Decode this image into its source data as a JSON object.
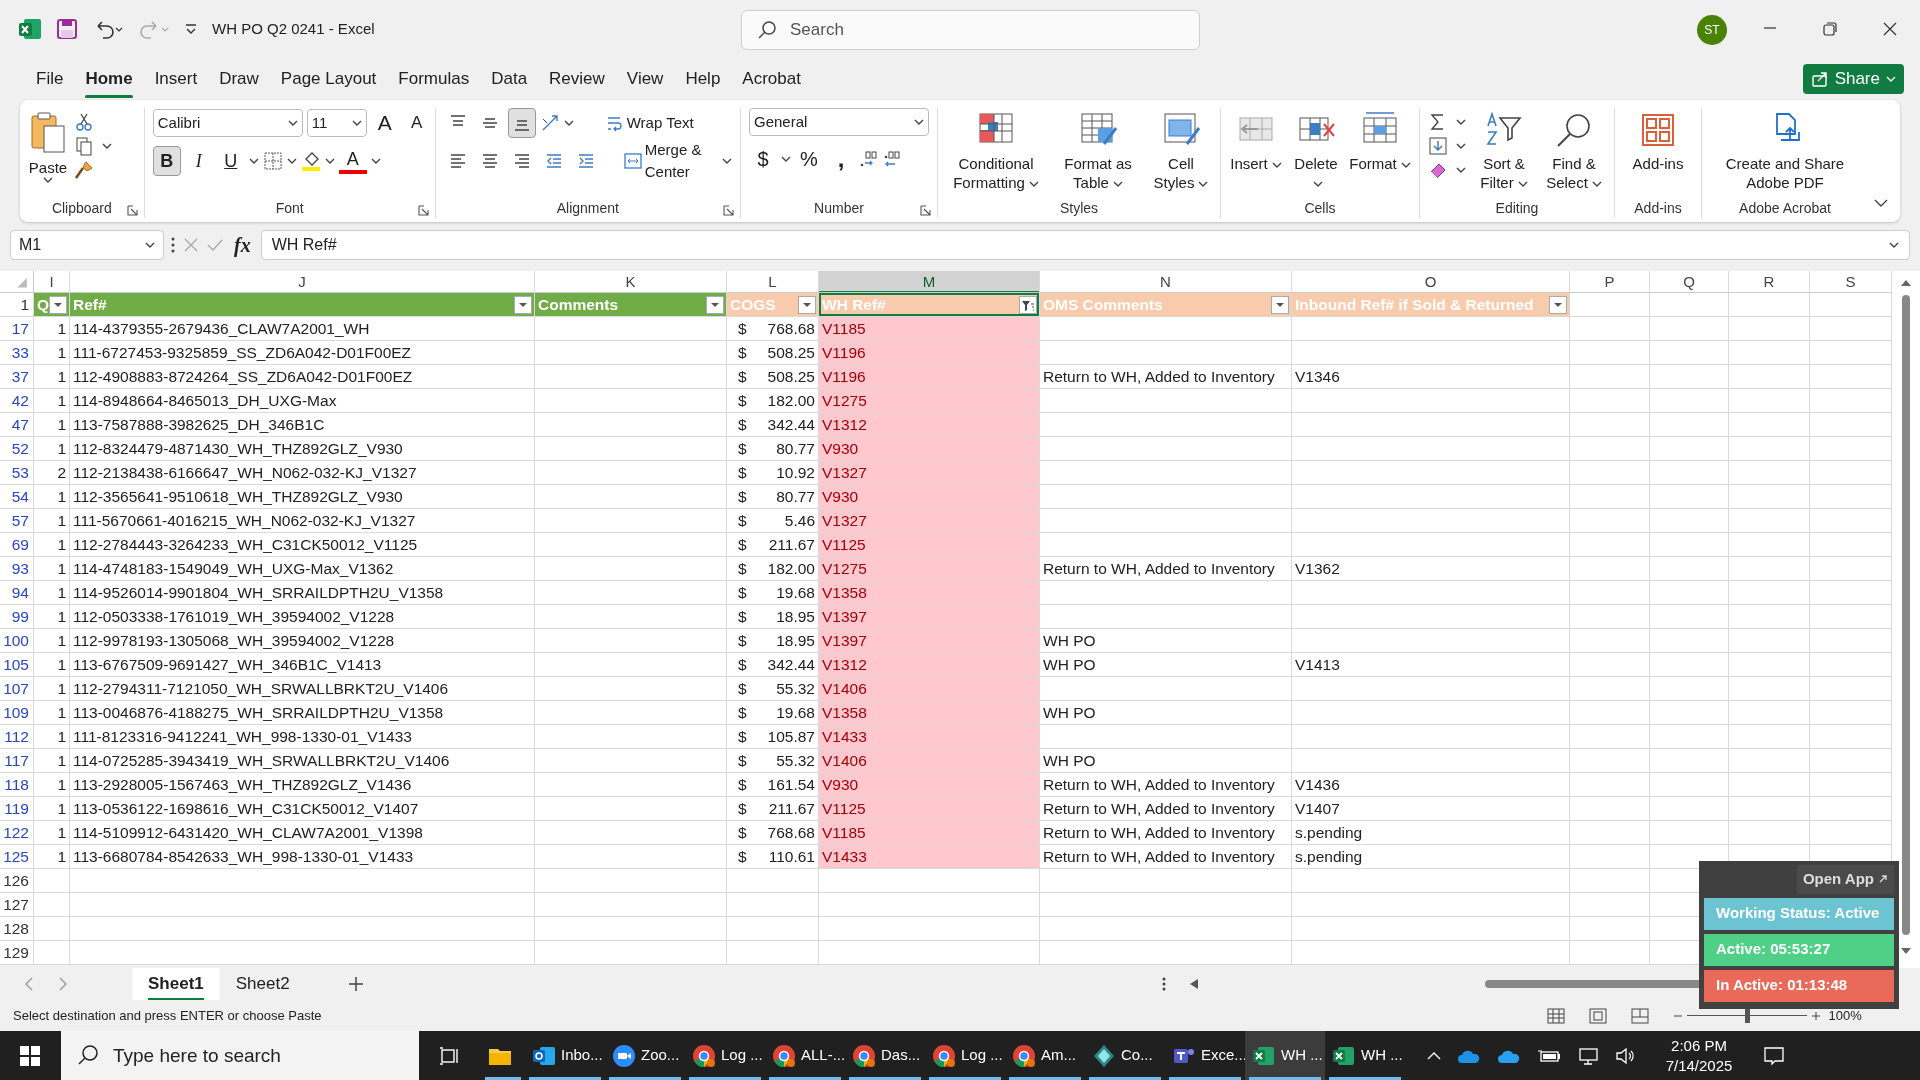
{
  "window": {
    "title": "WH PO Q2 0241  -  Excel",
    "search_placeholder": "Search",
    "avatar": "ST",
    "share": "Share"
  },
  "menu_tabs": [
    {
      "label": "File",
      "selected": false
    },
    {
      "label": "Home",
      "selected": true
    },
    {
      "label": "Insert",
      "selected": false
    },
    {
      "label": "Draw",
      "selected": false
    },
    {
      "label": "Page Layout",
      "selected": false
    },
    {
      "label": "Formulas",
      "selected": false
    },
    {
      "label": "Data",
      "selected": false
    },
    {
      "label": "Review",
      "selected": false
    },
    {
      "label": "View",
      "selected": false
    },
    {
      "label": "Help",
      "selected": false
    },
    {
      "label": "Acrobat",
      "selected": false
    }
  ],
  "ribbon": [
    {
      "kind": "clipboard",
      "label": "Clipboard",
      "paste": "Paste"
    },
    {
      "kind": "font",
      "label": "Font",
      "font_name": "Calibri",
      "font_size": "11",
      "grow": "A",
      "shrink": "A",
      "styles": [
        {
          "text": "B",
          "selected": true
        },
        {
          "text": "I",
          "selected": false
        },
        {
          "text": "U",
          "selected": false
        }
      ],
      "font_color": "A"
    },
    {
      "kind": "alignment",
      "label": "Alignment",
      "vertical": [
        {
          "selected": false
        },
        {
          "selected": false
        },
        {
          "selected": true
        }
      ],
      "wrap": "Wrap Text",
      "merge": "Merge & Center"
    },
    {
      "kind": "number",
      "label": "Number",
      "format": "General",
      "symbols": [
        "$",
        "%",
        ","
      ]
    },
    {
      "kind": "buttons",
      "label": "Styles",
      "buttons": [
        {
          "text": "Conditional Formatting",
          "kind": "conditional",
          "menu": true
        },
        {
          "text": "Format as Table",
          "kind": "table",
          "menu": true
        },
        {
          "text": "Cell Styles",
          "kind": "styles",
          "menu": true
        }
      ]
    },
    {
      "kind": "buttons",
      "label": "Cells",
      "buttons": [
        {
          "text": "Insert",
          "kind": "insert",
          "menu": true
        },
        {
          "text": "Delete",
          "kind": "delete",
          "menu": true
        },
        {
          "text": "Format",
          "kind": "format",
          "menu": true
        }
      ]
    },
    {
      "kind": "editing",
      "label": "Editing",
      "buttons": [
        {
          "text": "Sort & Filter",
          "kind": "sort",
          "menu": true
        },
        {
          "text": "Find & Select",
          "kind": "find",
          "menu": true
        }
      ]
    },
    {
      "kind": "buttons",
      "label": "Add-ins",
      "buttons": [
        {
          "text": "Add-ins",
          "kind": "addins",
          "menu": false
        }
      ]
    },
    {
      "kind": "buttons",
      "label": "Adobe Acrobat",
      "buttons": [
        {
          "text": "Create and Share Adobe PDF",
          "kind": "pdf",
          "menu": false
        }
      ]
    }
  ],
  "formula_bar": {
    "name_box": "M1",
    "fx": "fx",
    "value": "WH Ref#"
  },
  "columns": [
    {
      "letter": "I",
      "selected": false
    },
    {
      "letter": "J",
      "selected": false
    },
    {
      "letter": "K",
      "selected": false
    },
    {
      "letter": "L",
      "selected": false
    },
    {
      "letter": "M",
      "selected": true
    },
    {
      "letter": "N",
      "selected": false
    },
    {
      "letter": "O",
      "selected": false
    },
    {
      "letter": "P",
      "selected": false
    },
    {
      "letter": "Q",
      "selected": false
    },
    {
      "letter": "R",
      "selected": false
    },
    {
      "letter": "S",
      "selected": false
    }
  ],
  "header_row": {
    "number": "1",
    "cells": [
      {
        "text": "Q",
        "color": "#70ad47",
        "filtered": false,
        "selected": false
      },
      {
        "text": "Ref#",
        "color": "#70ad47",
        "filtered": false,
        "selected": false
      },
      {
        "text": "Comments",
        "color": "#70ad47",
        "filtered": false,
        "selected": false
      },
      {
        "text": "COGS",
        "color": "#f8cbad",
        "filtered": false,
        "selected": false
      },
      {
        "text": "WH Ref#",
        "color": "#f8cbad",
        "filtered": true,
        "selected": true
      },
      {
        "text": "OMS Comments",
        "color": "#f8cbad",
        "filtered": false,
        "selected": false
      },
      {
        "text": "Inbound Ref# if Sold & Returned",
        "color": "#f8cbad",
        "filtered": false,
        "selected": false
      }
    ]
  },
  "rows": [
    {
      "number": "17",
      "qty": "1",
      "ref": "114-4379355-2679436_CLAW7A2001_WH",
      "currency": "$",
      "cogs": "768.68",
      "wh_ref": "V1185"
    },
    {
      "number": "33",
      "qty": "1",
      "ref": "111-6727453-9325859_SS_ZD6A042-D01F00EZ",
      "currency": "$",
      "cogs": "508.25",
      "wh_ref": "V1196"
    },
    {
      "number": "37",
      "qty": "1",
      "ref": "112-4908883-8724264_SS_ZD6A042-D01F00EZ",
      "currency": "$",
      "cogs": "508.25",
      "wh_ref": "V1196",
      "oms": "Return to WH, Added to Inventory",
      "inbound": "V1346"
    },
    {
      "number": "42",
      "qty": "1",
      "ref": "114-8948664-8465013_DH_UXG-Max",
      "currency": "$",
      "cogs": "182.00",
      "wh_ref": "V1275"
    },
    {
      "number": "47",
      "qty": "1",
      "ref": "113-7587888-3982625_DH_346B1C",
      "currency": "$",
      "cogs": "342.44",
      "wh_ref": "V1312"
    },
    {
      "number": "52",
      "qty": "1",
      "ref": "112-8324479-4871430_WH_THZ892GLZ_V930",
      "currency": "$",
      "cogs": "80.77",
      "wh_ref": "V930"
    },
    {
      "number": "53",
      "qty": "2",
      "ref": "112-2138438-6166647_WH_N062-032-KJ_V1327",
      "currency": "$",
      "cogs": "10.92",
      "wh_ref": "V1327"
    },
    {
      "number": "54",
      "qty": "1",
      "ref": "112-3565641-9510618_WH_THZ892GLZ_V930",
      "currency": "$",
      "cogs": "80.77",
      "wh_ref": "V930"
    },
    {
      "number": "57",
      "qty": "1",
      "ref": "111-5670661-4016215_WH_N062-032-KJ_V1327",
      "currency": "$",
      "cogs": "5.46",
      "wh_ref": "V1327"
    },
    {
      "number": "69",
      "qty": "1",
      "ref": "112-2784443-3264233_WH_C31CK50012_V1125",
      "currency": "$",
      "cogs": "211.67",
      "wh_ref": "V1125"
    },
    {
      "number": "93",
      "qty": "1",
      "ref": "114-4748183-1549049_WH_UXG-Max_V1362",
      "currency": "$",
      "cogs": "182.00",
      "wh_ref": "V1275",
      "oms": "Return to WH, Added to Inventory",
      "inbound": "V1362"
    },
    {
      "number": "94",
      "qty": "1",
      "ref": "114-9526014-9901804_WH_SRRAILDPTH2U_V1358",
      "currency": "$",
      "cogs": "19.68",
      "wh_ref": "V1358"
    },
    {
      "number": "99",
      "qty": "1",
      "ref": "112-0503338-1761019_WH_39594002_V1228",
      "currency": "$",
      "cogs": "18.95",
      "wh_ref": "V1397"
    },
    {
      "number": "100",
      "qty": "1",
      "ref": "112-9978193-1305068_WH_39594002_V1228",
      "currency": "$",
      "cogs": "18.95",
      "wh_ref": "V1397",
      "oms": "WH PO"
    },
    {
      "number": "105",
      "qty": "1",
      "ref": "113-6767509-9691427_WH_346B1C_V1413",
      "currency": "$",
      "cogs": "342.44",
      "wh_ref": "V1312",
      "oms": "WH PO",
      "inbound": "V1413"
    },
    {
      "number": "107",
      "qty": "1",
      "ref": "112-2794311-7121050_WH_SRWALLBRKT2U_V1406",
      "currency": "$",
      "cogs": "55.32",
      "wh_ref": "V1406"
    },
    {
      "number": "109",
      "qty": "1",
      "ref": "113-0046876-4188275_WH_SRRAILDPTH2U_V1358",
      "currency": "$",
      "cogs": "19.68",
      "wh_ref": "V1358",
      "oms": "WH PO"
    },
    {
      "number": "112",
      "qty": "1",
      "ref": "111-8123316-9412241_WH_998-1330-01_V1433",
      "currency": "$",
      "cogs": "105.87",
      "wh_ref": "V1433"
    },
    {
      "number": "117",
      "qty": "1",
      "ref": "114-0725285-3943419_WH_SRWALLBRKT2U_V1406",
      "currency": "$",
      "cogs": "55.32",
      "wh_ref": "V1406",
      "oms": "WH PO"
    },
    {
      "number": "118",
      "qty": "1",
      "ref": "113-2928005-1567463_WH_THZ892GLZ_V1436",
      "currency": "$",
      "cogs": "161.54",
      "wh_ref": "V930",
      "oms": "Return to WH, Added to Inventory",
      "inbound": "V1436"
    },
    {
      "number": "119",
      "qty": "1",
      "ref": "113-0536122-1698616_WH_C31CK50012_V1407",
      "currency": "$",
      "cogs": "211.67",
      "wh_ref": "V1125",
      "oms": "Return to WH, Added to Inventory",
      "inbound": "V1407"
    },
    {
      "number": "122",
      "qty": "1",
      "ref": "114-5109912-6431420_WH_CLAW7A2001_V1398",
      "currency": "$",
      "cogs": "768.68",
      "wh_ref": "V1185",
      "oms": "Return to WH, Added to Inventory",
      "inbound": "s.pending"
    },
    {
      "number": "125",
      "qty": "1",
      "ref": "113-6680784-8542633_WH_998-1330-01_V1433",
      "currency": "$",
      "cogs": "110.61",
      "wh_ref": "V1433",
      "oms": "Return to WH, Added to Inventory",
      "inbound": "s.pending"
    }
  ],
  "empty_rows": [
    "126",
    "127",
    "128",
    "129"
  ],
  "sheet_tabs": [
    {
      "label": "Sheet1",
      "selected": true
    },
    {
      "label": "Sheet2",
      "selected": false
    }
  ],
  "status_bar": {
    "message": "Select destination and press ENTER or choose Paste",
    "zoom": "100%",
    "zoom_slider": {
      "level": 0.5
    }
  },
  "tracker": {
    "open_app": "Open App",
    "items": [
      {
        "text": "Working Status: Active",
        "color": "#6cc4d3"
      },
      {
        "text": "Active: 05:53:27",
        "color": "#50cf86"
      },
      {
        "text": "In Active: 01:13:48",
        "color": "#ea6a5a"
      }
    ]
  },
  "taskbar": {
    "search_placeholder": "Type here to search",
    "apps": [
      {
        "kind": "folder",
        "active": false
      },
      {
        "kind": "mail",
        "label": "Inbo...",
        "active": false
      },
      {
        "kind": "video",
        "label": "Zoo...",
        "active": false
      },
      {
        "kind": "browser",
        "label": "Log ...",
        "active": false
      },
      {
        "kind": "browser",
        "label": "ALL-...",
        "active": false
      },
      {
        "kind": "browser",
        "label": "Das...",
        "active": false
      },
      {
        "kind": "browser",
        "label": "Log ...",
        "active": false
      },
      {
        "kind": "browser",
        "label": "Am...",
        "active": false
      },
      {
        "kind": "diamond",
        "label": "Co...",
        "active": false
      },
      {
        "kind": "chat",
        "label": "Exce...",
        "active": false
      },
      {
        "kind": "sheet",
        "label": "WH ...",
        "active": true
      },
      {
        "kind": "sheet",
        "label": "WH ...",
        "active": false
      }
    ],
    "time": "2:06 PM",
    "date": "7/14/2025"
  }
}
